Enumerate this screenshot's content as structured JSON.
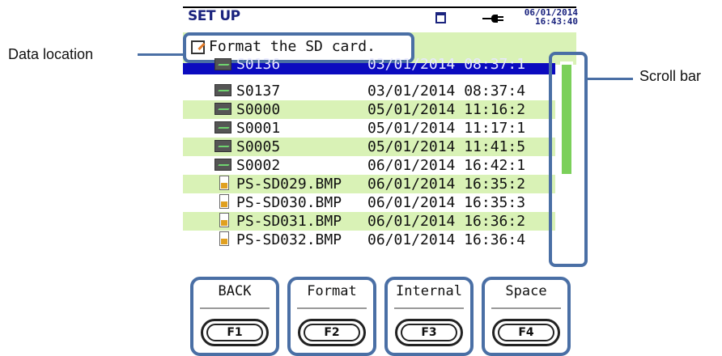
{
  "callouts": {
    "data_location": "Data location",
    "scroll_bar": "Scroll bar"
  },
  "header": {
    "title": "SET UP",
    "date": "06/01/2014",
    "time": "16:43:40",
    "sd_icon": "sd-card-icon",
    "power_icon": "power-plug-icon"
  },
  "message": {
    "icon": "edit-note-icon",
    "text": "Format the SD card."
  },
  "files": [
    {
      "name": "S0136",
      "date": "03/01/2014 08:37:1",
      "type": "wave",
      "selected": true
    },
    {
      "name": "S0137",
      "date": "03/01/2014 08:37:4",
      "type": "wave"
    },
    {
      "name": "S0000",
      "date": "05/01/2014 11:16:2",
      "type": "wave"
    },
    {
      "name": "S0001",
      "date": "05/01/2014 11:17:1",
      "type": "wave"
    },
    {
      "name": "S0005",
      "date": "05/01/2014 11:41:5",
      "type": "wave"
    },
    {
      "name": "S0002",
      "date": "06/01/2014 16:42:1",
      "type": "wave"
    },
    {
      "name": "PS-SD029.BMP",
      "date": "06/01/2014 16:35:2",
      "type": "bmp"
    },
    {
      "name": "PS-SD030.BMP",
      "date": "06/01/2014 16:35:3",
      "type": "bmp"
    },
    {
      "name": "PS-SD031.BMP",
      "date": "06/01/2014 16:36:2",
      "type": "bmp"
    },
    {
      "name": "PS-SD032.BMP",
      "date": "06/01/2014 16:36:4",
      "type": "bmp"
    }
  ],
  "colors": {
    "accent": "#4a6fa5",
    "row_highlight": "#d9f2b6",
    "selection": "#0b0bbf",
    "scroll_thumb": "#7bd05a",
    "title": "#1a237e"
  },
  "function_keys": [
    {
      "label": "BACK",
      "key": "F1"
    },
    {
      "label": "Format",
      "key": "F2"
    },
    {
      "label": "Internal",
      "key": "F3"
    },
    {
      "label": "Space",
      "key": "F4"
    }
  ]
}
